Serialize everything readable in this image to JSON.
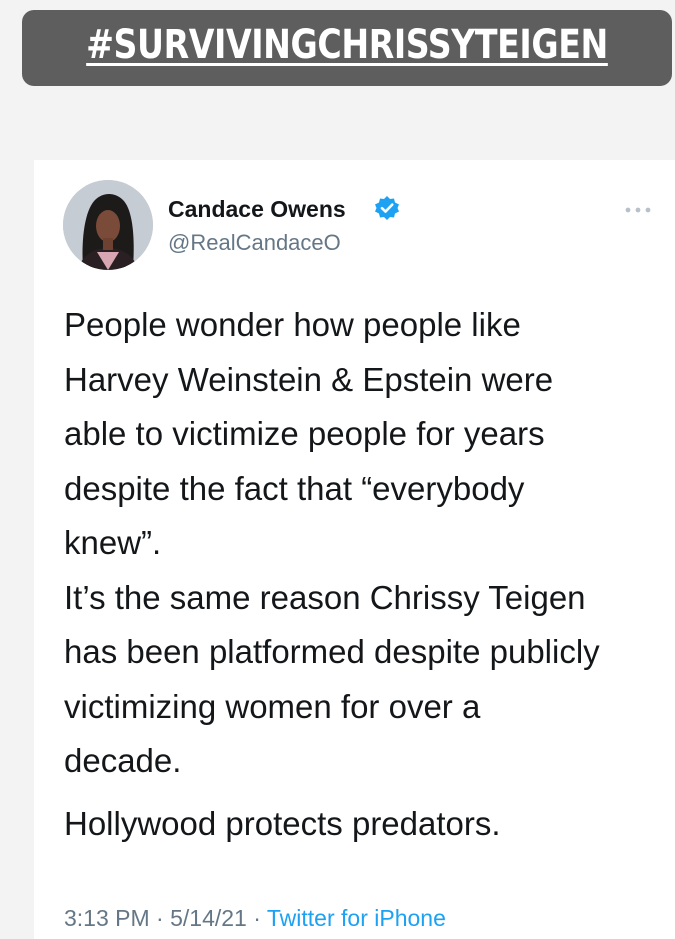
{
  "story": {
    "hashtag": "#SURVIVINGCHRISSYTEIGEN"
  },
  "tweet": {
    "author_name": "Candace Owens",
    "handle": "@RealCandaceO",
    "verified_icon": "verified-badge-icon",
    "more_icon": "more-options-icon",
    "lines": [
      "People wonder how people like",
      "Harvey Weinstein &  Epstein were",
      "able to victimize people for years",
      "despite the fact that “everybody",
      "knew”.",
      "It’s the same reason Chrissy Teigen",
      "has been platformed despite publicly",
      "victimizing women for over a",
      "decade.",
      "Hollywood protects predators."
    ],
    "time": "3:13 PM",
    "date": "5/14/21",
    "separator": "·",
    "source": "Twitter for iPhone"
  },
  "colors": {
    "banner": "#5e5e5e",
    "verified": "#1da1f2",
    "muted_text": "#657786",
    "link": "#1da1f2"
  }
}
